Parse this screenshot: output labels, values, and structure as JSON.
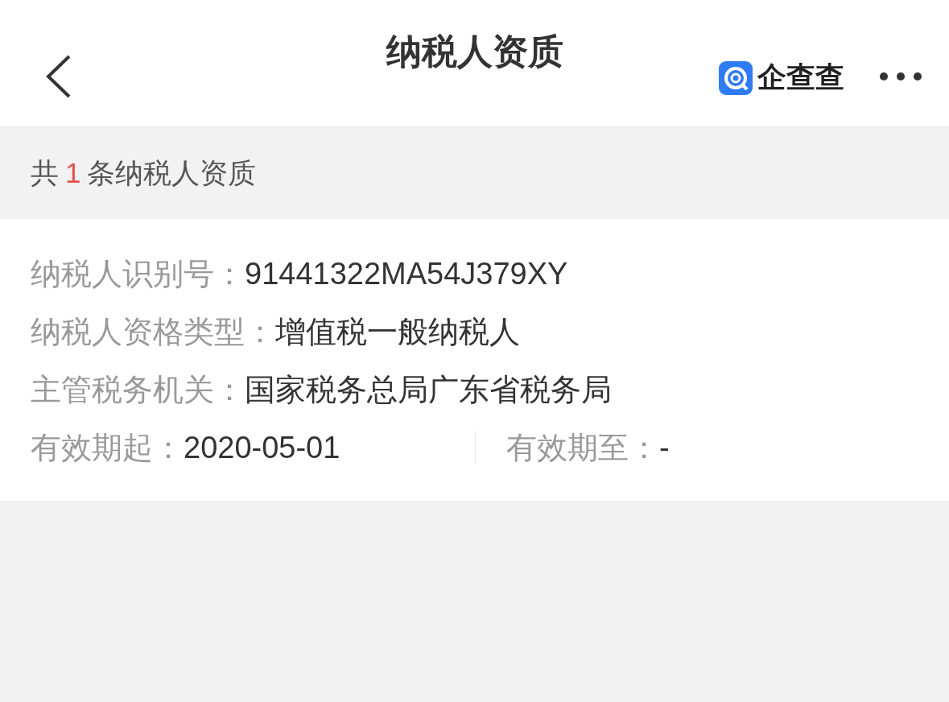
{
  "header": {
    "title": "纳税人资质",
    "brand": "企查查"
  },
  "summary": {
    "prefix": "共",
    "count": "1",
    "suffix": "条纳税人资质"
  },
  "rows": [
    {
      "fields": [
        {
          "label": "纳税人识别号：",
          "value": "91441322MA54J379XY"
        }
      ]
    },
    {
      "fields": [
        {
          "label": "纳税人资格类型：",
          "value": "增值税一般纳税人"
        }
      ]
    },
    {
      "fields": [
        {
          "label": "主管税务机关：",
          "value": "国家税务总局广东省税务局"
        }
      ]
    },
    {
      "fields": [
        {
          "label": "有效期起：",
          "value": "2020-05-01"
        },
        {
          "label": "有效期至：",
          "value": "-"
        }
      ]
    }
  ]
}
